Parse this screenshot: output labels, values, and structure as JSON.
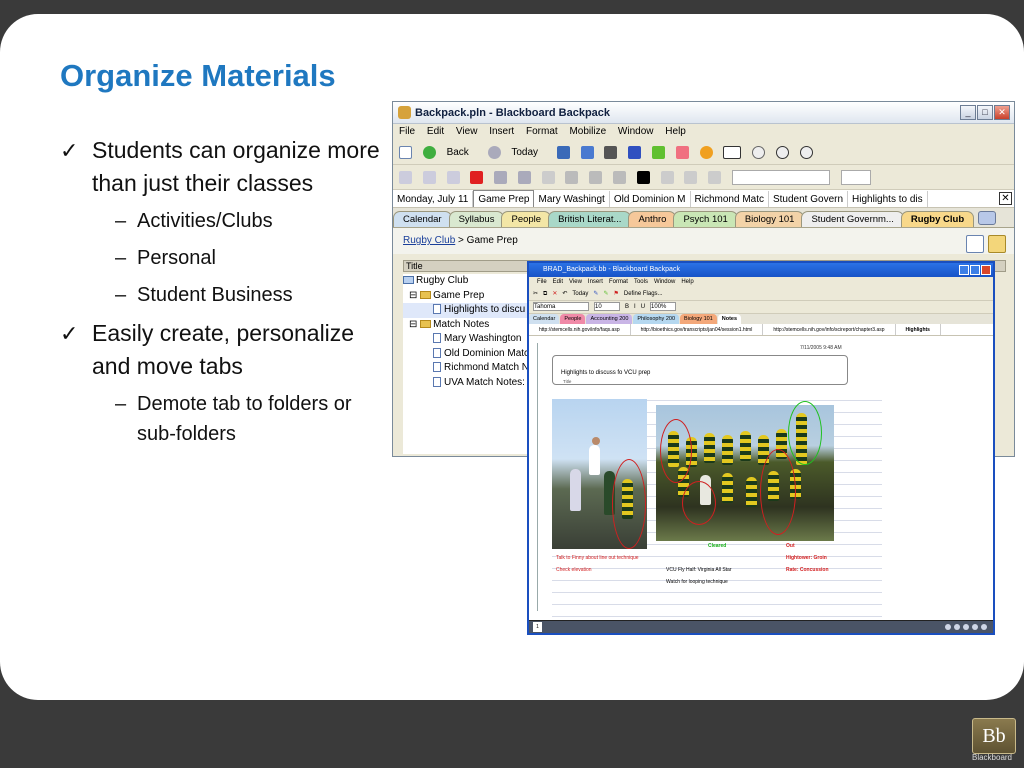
{
  "slide": {
    "title": "Organize Materials",
    "bullets": [
      {
        "text": "Students can organize more than just their classes",
        "subs": [
          "Activities/Clubs",
          "Personal",
          "Student Business"
        ]
      },
      {
        "text": "Easily create, personalize and move tabs",
        "subs": [
          "Demote tab to folders or sub-folders"
        ]
      }
    ],
    "check_glyph": "✓",
    "dash_glyph": "–",
    "logo_mark": "Bb",
    "logo_text": "Blackboard"
  },
  "window1": {
    "title": "Backpack.pln - Blackboard Backpack",
    "menu": [
      "File",
      "Edit",
      "View",
      "Insert",
      "Format",
      "Mobilize",
      "Window",
      "Help"
    ],
    "toolbar": {
      "back_label": "Back",
      "today_label": "Today"
    },
    "doc_tabs": [
      "Monday, July 11",
      "Game Prep",
      "Mary Washingt",
      "Old Dominion M",
      "Richmond Matc",
      "Student Govern",
      "Highlights to dis"
    ],
    "tabs": [
      {
        "label": "Calendar",
        "color": "#cfe0f0"
      },
      {
        "label": "Syllabus",
        "color": "#d9e8d0"
      },
      {
        "label": "People",
        "color": "#f3e6a6"
      },
      {
        "label": "British Literat...",
        "color": "#a9d8c8"
      },
      {
        "label": "Anthro",
        "color": "#f6c89a"
      },
      {
        "label": "Psych 101",
        "color": "#c9e6b5"
      },
      {
        "label": "Biology 101",
        "color": "#f3d3a8"
      },
      {
        "label": "Student Governm...",
        "color": "#eeeeee"
      },
      {
        "label": "Rugby Club",
        "color": "#f8d88a"
      }
    ],
    "breadcrumb": {
      "link": "Rugby Club",
      "separator": ">",
      "current": "Game Prep"
    },
    "column_header": "Title",
    "tree": [
      {
        "label": "Rugby Club",
        "kind": "folder",
        "level": 0
      },
      {
        "label": "Game Prep",
        "kind": "folder",
        "level": 1
      },
      {
        "label": "Highlights to discu",
        "kind": "page",
        "level": 2
      },
      {
        "label": "Match Notes",
        "kind": "folder",
        "level": 1
      },
      {
        "label": "Mary Washington",
        "kind": "page",
        "level": 2
      },
      {
        "label": "Old Dominion Matc",
        "kind": "page",
        "level": 2
      },
      {
        "label": "Richmond Match N",
        "kind": "page",
        "level": 2
      },
      {
        "label": "UVA Match Notes:",
        "kind": "page",
        "level": 2
      }
    ]
  },
  "window2": {
    "title": "BRAD_Backpack.bb - Blackboard Backpack",
    "menu": [
      "File",
      "Edit",
      "View",
      "Insert",
      "Format",
      "Tools",
      "Window",
      "Help"
    ],
    "font_name": "Tahoma",
    "font_size": "10",
    "zoom": "100%",
    "today_label": "Today",
    "flags_label": "Define Flags...",
    "tabs": [
      {
        "label": "Calendar",
        "color": "#cfe0f0"
      },
      {
        "label": "People",
        "color": "#f08aa8"
      },
      {
        "label": "Accounting 200",
        "color": "#c9b5e6"
      },
      {
        "label": "Philosophy 200",
        "color": "#b5d8f0"
      },
      {
        "label": "Biology 101",
        "color": "#f3a87a"
      },
      {
        "label": "Notes",
        "color": "#ffffff"
      }
    ],
    "doc_tabs": [
      "http://stemcells.nih.gov/info/faqs.asp",
      "http://bioethics.gov/transcripts/jan04/session1.html",
      "http://stemcells.nih.gov/info/scireport/chapter3.asp",
      "Highlights"
    ],
    "note": {
      "timestamp": "7/11/2005 9:48 AM",
      "title": "Highlights to discuss fo VCU prep",
      "title_field": "Title",
      "left_notes": [
        "Talk to Finny about line out technique",
        "Check elevation"
      ],
      "mid_notes": [
        "VCU Fly Half: Virginia All Star",
        "Watch for looping technique"
      ],
      "cleared_label": "Cleared",
      "out_label": "Out",
      "out_items": [
        "Hightower: Groin",
        "Rate: Concussion"
      ]
    },
    "page_number": "1",
    "colors": {
      "red_note": "#d42020",
      "green_note": "#18b018",
      "title_blue": "#1753c7"
    }
  },
  "colors": {
    "slide_title": "#1f78c0",
    "background": "#3a3a3a"
  }
}
